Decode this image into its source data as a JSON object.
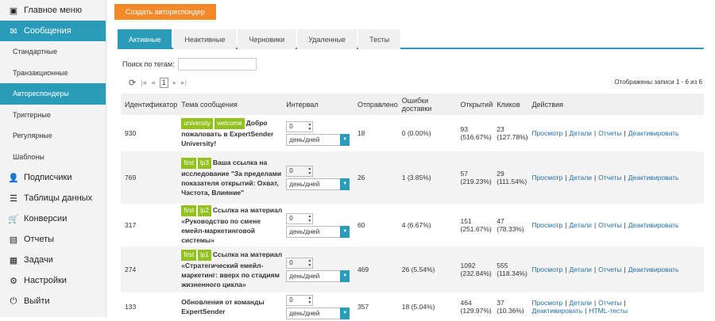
{
  "sidebar": {
    "items": [
      {
        "label": "Главное меню",
        "icon": "window-icon"
      },
      {
        "label": "Сообщения",
        "icon": "envelope-icon",
        "active": true
      },
      {
        "label": "Стандартные",
        "sub": true
      },
      {
        "label": "Транзакционные",
        "sub": true
      },
      {
        "label": "Автореспондеры",
        "sub": true,
        "active": true
      },
      {
        "label": "Триггерные",
        "sub": true
      },
      {
        "label": "Регулярные",
        "sub": true
      },
      {
        "label": "Шаблоны",
        "sub": true
      },
      {
        "label": "Подписчики",
        "icon": "user-icon"
      },
      {
        "label": "Таблицы данных",
        "icon": "list-icon"
      },
      {
        "label": "Конверсии",
        "icon": "cart-icon"
      },
      {
        "label": "Отчеты",
        "icon": "chart-icon"
      },
      {
        "label": "Задачи",
        "icon": "calendar-icon"
      },
      {
        "label": "Настройки",
        "icon": "gear-icon"
      },
      {
        "label": "Выйти",
        "icon": "power-icon"
      }
    ]
  },
  "toolbar": {
    "create_label": "Создать автореспондер"
  },
  "tabs": [
    "Активные",
    "Неактивные",
    "Черновики",
    "Удаленные",
    "Тесты"
  ],
  "search": {
    "label": "Поиск по тегам:",
    "value": ""
  },
  "pager": {
    "page": "1",
    "records": "Отображены записи 1 - 6 из 6"
  },
  "table": {
    "headers": [
      "Идентификатор",
      "Тема сообщения",
      "Интервал",
      "Отправлено",
      "Ошибки доставки",
      "Открытий",
      "Кликов",
      "Действия"
    ],
    "rows": [
      {
        "id": "930",
        "tags": [
          "university",
          "welcome"
        ],
        "subject": "Добро пожаловать в ExpertSender University!",
        "interval": "0",
        "unit": "день/дней",
        "sent": "18",
        "errors": "0 (0.00%)",
        "opens": "93",
        "opens_pct": "(516.67%)",
        "clicks": "23",
        "clicks_pct": "(127.78%)",
        "actions": [
          "Просмотр",
          "Детали",
          "Отчеты",
          "Деактивировать"
        ]
      },
      {
        "id": "769",
        "tags": [
          "first",
          "lp3"
        ],
        "subject": "Ваша ссылка на исследование \"За пределами показателя открытий: Охват, Частота, Влияние\"",
        "interval": "0",
        "unit": "день/дней",
        "sent": "26",
        "errors": "1 (3.85%)",
        "opens": "57",
        "opens_pct": "(219.23%)",
        "clicks": "29",
        "clicks_pct": "(111.54%)",
        "actions": [
          "Просмотр",
          "Детали",
          "Отчеты",
          "Деактивировать"
        ]
      },
      {
        "id": "317",
        "tags": [
          "first",
          "lp2"
        ],
        "subject": "Ссылка на материал «Руководство по смене емейл-маркетинговой системы»",
        "interval": "0",
        "unit": "день/дней",
        "sent": "60",
        "errors": "4 (6.67%)",
        "opens": "151",
        "opens_pct": "(251.67%)",
        "clicks": "47",
        "clicks_pct": "(78.33%)",
        "actions": [
          "Просмотр",
          "Детали",
          "Отчеты",
          "Деактивировать"
        ]
      },
      {
        "id": "274",
        "tags": [
          "first",
          "lp1"
        ],
        "subject": "Ссылка на материал «Стратегический емейл-маркетинг: вверх по стадиям жизненного цикла»",
        "interval": "0",
        "unit": "день/дней",
        "sent": "469",
        "errors": "26 (5.54%)",
        "opens": "1092",
        "opens_pct": "(232.84%)",
        "clicks": "555",
        "clicks_pct": "(118.34%)",
        "actions": [
          "Просмотр",
          "Детали",
          "Отчеты",
          "Деактивировать"
        ]
      },
      {
        "id": "133",
        "tags": [],
        "subject": "Обновления от команды ExpertSender",
        "interval": "0",
        "unit": "день/дней",
        "sent": "357",
        "errors": "18 (5.04%)",
        "opens": "464",
        "opens_pct": "(129.97%)",
        "clicks": "37",
        "clicks_pct": "(10.36%)",
        "actions": [
          "Просмотр",
          "Детали",
          "Отчеты",
          "Деактивировать",
          "HTML-тесты"
        ]
      }
    ]
  },
  "colors": {
    "accent": "#2a9bb8",
    "orange": "#f4892a",
    "tag": "#93c11e",
    "link": "#1f6ea8"
  }
}
